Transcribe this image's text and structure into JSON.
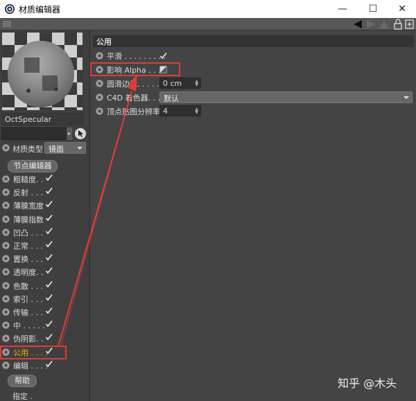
{
  "window": {
    "title": "材质编辑器",
    "minimize": "—",
    "maximize": "☐",
    "close": "✕"
  },
  "material": {
    "name": "OctSpecular",
    "type_label": "材质类型",
    "type_value": "镜面",
    "node_editor_label": "节点编辑器",
    "channels": [
      {
        "label": "粗糙度. ."
      },
      {
        "label": "反射 . . ."
      },
      {
        "label": "薄膜宽度"
      },
      {
        "label": "薄膜指数"
      },
      {
        "label": "凹凸 . . ."
      },
      {
        "label": "正常 . . ."
      },
      {
        "label": "置换 . . ."
      },
      {
        "label": "透明度. ."
      },
      {
        "label": "色散 . . ."
      },
      {
        "label": "索引 . . ."
      },
      {
        "label": "传输 . . ."
      },
      {
        "label": "中 . . . . ."
      },
      {
        "label": "伪阴影. ."
      },
      {
        "label": "公用 . . . ."
      },
      {
        "label": "编辑 . . . ."
      }
    ],
    "help_label": "帮助",
    "assigned_label": "指定 ."
  },
  "properties": {
    "section_title": "公用",
    "smooth_label": "平滑 . . . . . . . . .",
    "affect_alpha_label": "影响 Alpha . . . .",
    "round_edge_label": "圆滑边缘. . . . . .",
    "round_edge_value": "0 cm",
    "c4d_shader_label": "C4D 着色器. . . . .",
    "c4d_shader_value": "默认",
    "vertex_map_label": "顶点贴图分辨率",
    "vertex_map_value": "4"
  },
  "watermark": "知乎 @木头",
  "colors": {
    "annotation_red": "#e23b3b",
    "active_channel_label": "#e8b400"
  }
}
